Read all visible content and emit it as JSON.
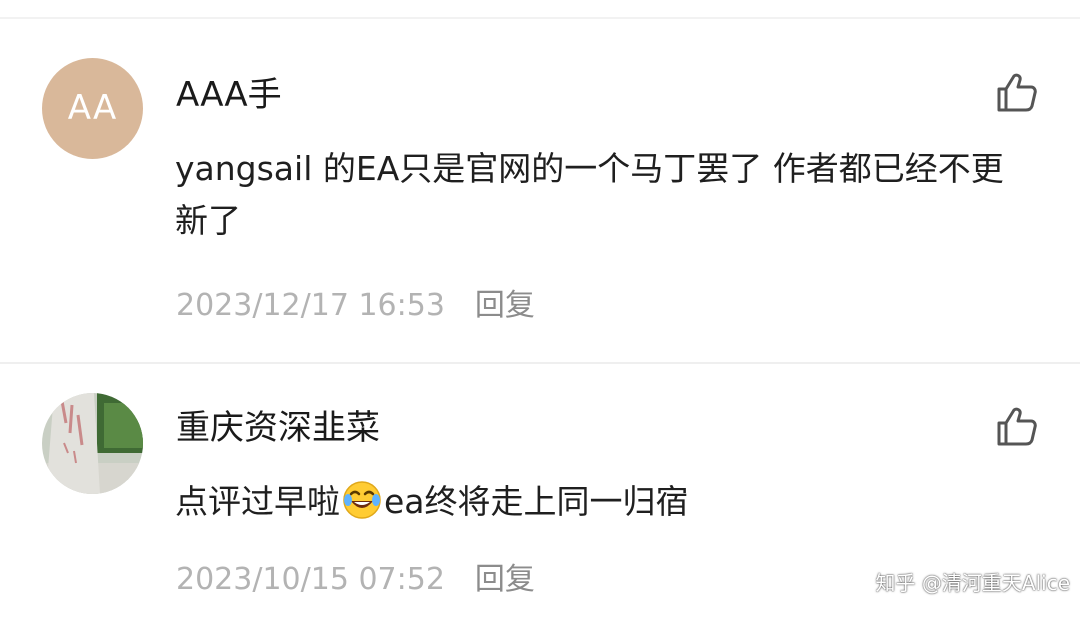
{
  "comments": [
    {
      "avatar": {
        "type": "initials",
        "text": "AA",
        "color": "#d9b89a"
      },
      "username": "AAA手",
      "text": "yangsail 的EA只是官网的一个马丁罢了 作者都已经不更新了",
      "timestamp": "2023/12/17 16:53",
      "reply_label": "回复",
      "like_icon": "thumbs-up-icon"
    },
    {
      "avatar": {
        "type": "photo",
        "description_icon": "stone-monument-photo"
      },
      "username": "重庆资深韭菜",
      "text_before_emoji": "点评过早啦",
      "emoji": "laughing-tears-emoji",
      "text_after_emoji": "ea终将走上同一归宿",
      "timestamp": "2023/10/15 07:52",
      "reply_label": "回复",
      "like_icon": "thumbs-up-icon"
    }
  ],
  "watermark": "知乎 @清河重天Alice"
}
